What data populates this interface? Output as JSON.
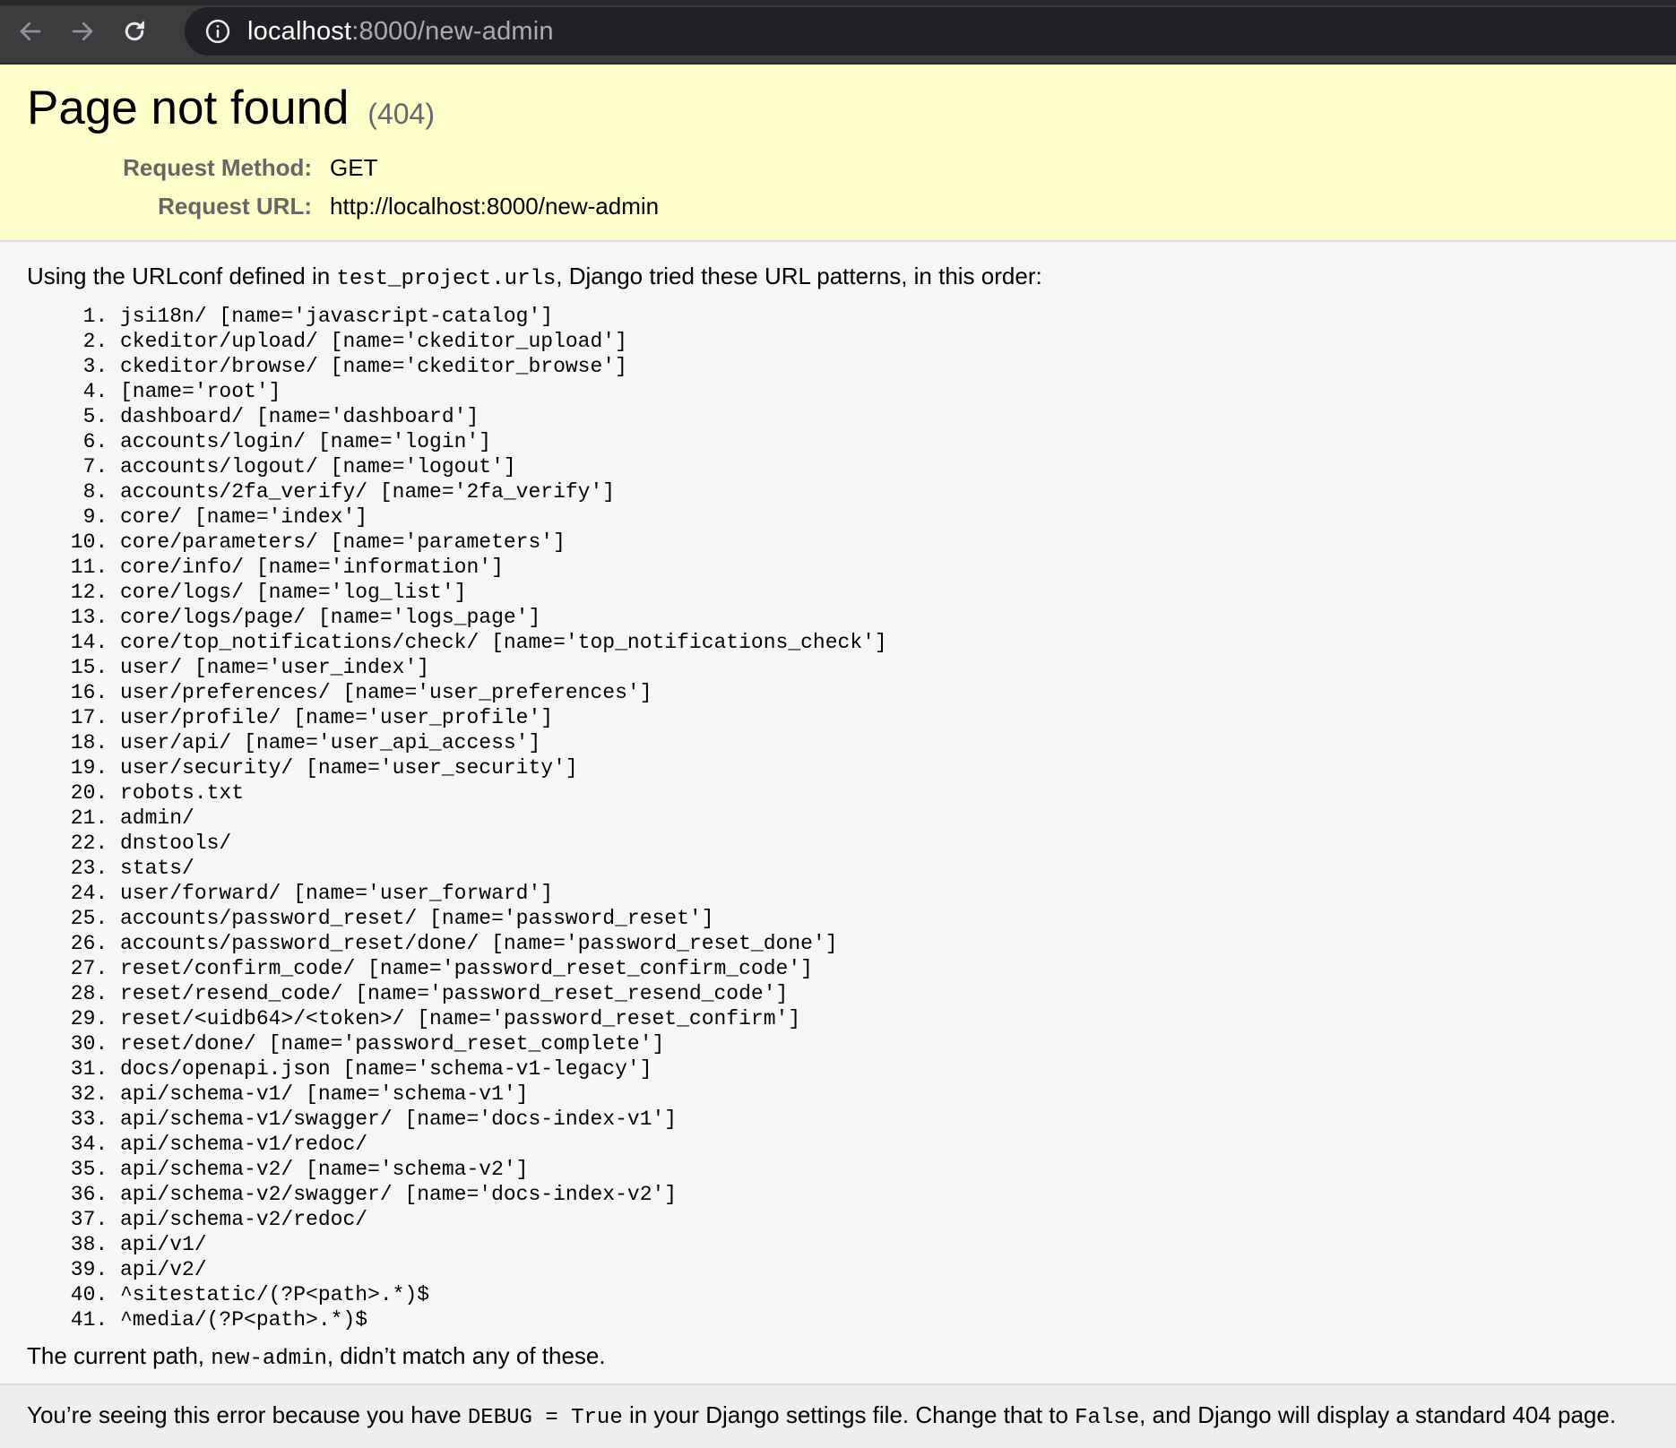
{
  "browser": {
    "url_host": "localhost",
    "url_rest": ":8000/new-admin"
  },
  "summary": {
    "title": "Page not found",
    "status_code": "(404)",
    "request_method_label": "Request Method:",
    "request_method": "GET",
    "request_url_label": "Request URL:",
    "request_url": "http://localhost:8000/new-admin"
  },
  "info": {
    "intro_before": "Using the URLconf defined in ",
    "urlconf": "test_project.urls",
    "intro_after": ", Django tried these URL patterns, in this order:",
    "patterns": [
      "jsi18n/ [name='javascript-catalog']",
      "ckeditor/upload/ [name='ckeditor_upload']",
      "ckeditor/browse/ [name='ckeditor_browse']",
      "[name='root']",
      "dashboard/ [name='dashboard']",
      "accounts/login/ [name='login']",
      "accounts/logout/ [name='logout']",
      "accounts/2fa_verify/ [name='2fa_verify']",
      "core/ [name='index']",
      "core/parameters/ [name='parameters']",
      "core/info/ [name='information']",
      "core/logs/ [name='log_list']",
      "core/logs/page/ [name='logs_page']",
      "core/top_notifications/check/ [name='top_notifications_check']",
      "user/ [name='user_index']",
      "user/preferences/ [name='user_preferences']",
      "user/profile/ [name='user_profile']",
      "user/api/ [name='user_api_access']",
      "user/security/ [name='user_security']",
      "robots.txt",
      "admin/",
      "dnstools/",
      "stats/",
      "user/forward/ [name='user_forward']",
      "accounts/password_reset/ [name='password_reset']",
      "accounts/password_reset/done/ [name='password_reset_done']",
      "reset/confirm_code/ [name='password_reset_confirm_code']",
      "reset/resend_code/ [name='password_reset_resend_code']",
      "reset/<uidb64>/<token>/ [name='password_reset_confirm']",
      "reset/done/ [name='password_reset_complete']",
      "docs/openapi.json [name='schema-v1-legacy']",
      "api/schema-v1/ [name='schema-v1']",
      "api/schema-v1/swagger/ [name='docs-index-v1']",
      "api/schema-v1/redoc/",
      "api/schema-v2/ [name='schema-v2']",
      "api/schema-v2/swagger/ [name='docs-index-v2']",
      "api/schema-v2/redoc/",
      "api/v1/",
      "api/v2/",
      "^sitestatic/(?P<path>.*)$",
      "^media/(?P<path>.*)$"
    ],
    "nomatch_before": "The current path, ",
    "current_path": "new-admin",
    "nomatch_after": ", didn’t match any of these."
  },
  "explanation": {
    "text1": "You’re seeing this error because you have ",
    "debug_code": "DEBUG = True",
    "text2": " in your Django settings file. Change that to ",
    "false_code": "False",
    "text3": ", and Django will display a standard 404 page."
  }
}
